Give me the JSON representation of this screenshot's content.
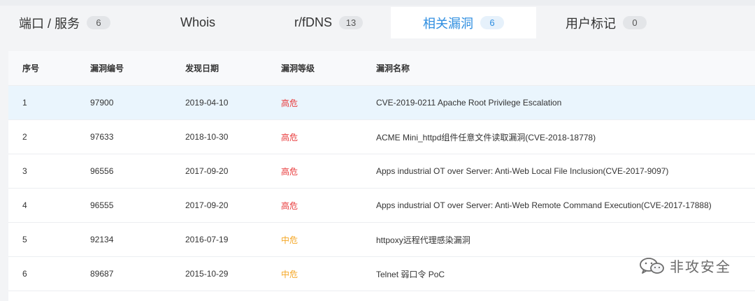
{
  "tabs": [
    {
      "label": "端口 / 服务",
      "count": "6",
      "active": false
    },
    {
      "label": "Whois",
      "count": "",
      "active": false
    },
    {
      "label": "r/fDNS",
      "count": "13",
      "active": false
    },
    {
      "label": "相关漏洞",
      "count": "6",
      "active": true
    },
    {
      "label": "用户标记",
      "count": "0",
      "active": false
    }
  ],
  "table": {
    "headers": [
      "序号",
      "漏洞编号",
      "发现日期",
      "漏洞等级",
      "漏洞名称"
    ],
    "rows": [
      {
        "index": "1",
        "id": "97900",
        "date": "2019-04-10",
        "level": "高危",
        "level_color": "#e8393a",
        "name": "CVE-2019-0211 Apache Root Privilege Escalation"
      },
      {
        "index": "2",
        "id": "97633",
        "date": "2018-10-30",
        "level": "高危",
        "level_color": "#e8393a",
        "name": "ACME Mini_httpd组件任意文件读取漏洞(CVE-2018-18778)"
      },
      {
        "index": "3",
        "id": "96556",
        "date": "2017-09-20",
        "level": "高危",
        "level_color": "#e8393a",
        "name": "Apps industrial OT over Server: Anti-Web Local File Inclusion(CVE-2017-9097)"
      },
      {
        "index": "4",
        "id": "96555",
        "date": "2017-09-20",
        "level": "高危",
        "level_color": "#e8393a",
        "name": "Apps industrial OT over Server: Anti-Web Remote Command Execution(CVE-2017-17888)"
      },
      {
        "index": "5",
        "id": "92134",
        "date": "2016-07-19",
        "level": "中危",
        "level_color": "#f5a623",
        "name": "httpoxy远程代理感染漏洞"
      },
      {
        "index": "6",
        "id": "89687",
        "date": "2015-10-29",
        "level": "中危",
        "level_color": "#f5a623",
        "name": "Telnet 弱口令 PoC"
      }
    ]
  },
  "watermark": {
    "text": "非攻安全"
  }
}
